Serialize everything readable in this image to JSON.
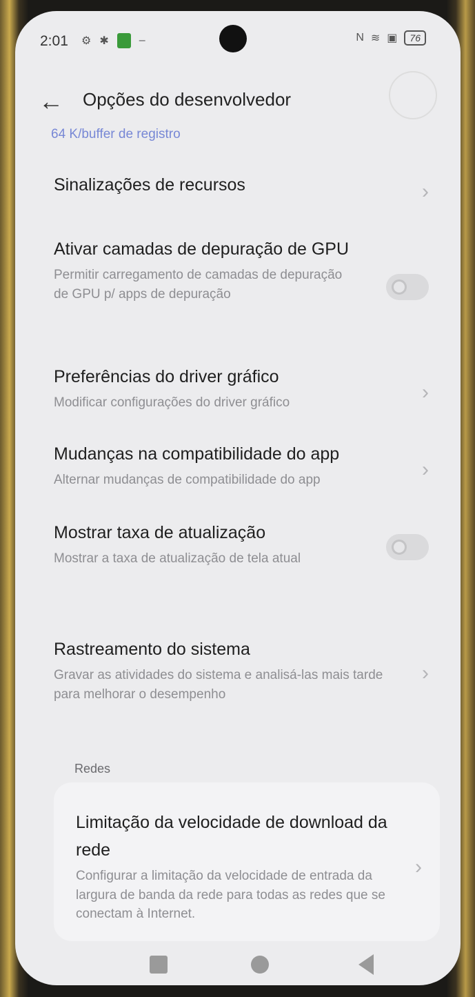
{
  "status": {
    "time": "2:01",
    "battery": "76"
  },
  "header": {
    "title": "Opções do desenvolvedor"
  },
  "cut_off_text": "64 K/buffer de registro",
  "items": [
    {
      "title": "Sinalizações de recursos",
      "subtitle": "",
      "control": "chevron"
    },
    {
      "title": "Ativar camadas de depuração de GPU",
      "subtitle": "Permitir carregamento de camadas de depuração de GPU p/ apps de depuração",
      "control": "toggle",
      "state": "off"
    },
    {
      "title": "Preferências do driver gráfico",
      "subtitle": "Modificar configurações do driver gráfico",
      "control": "chevron"
    },
    {
      "title": "Mudanças na compatibilidade do app",
      "subtitle": "Alternar mudanças de compatibilidade do app",
      "control": "chevron"
    },
    {
      "title": "Mostrar taxa de atualização",
      "subtitle": "Mostrar a taxa de atualização de tela atual",
      "control": "toggle",
      "state": "off"
    },
    {
      "title": "Rastreamento do sistema",
      "subtitle": "Gravar as atividades do sistema e analisá-las mais tarde para melhorar o desempenho",
      "control": "chevron"
    }
  ],
  "section": {
    "label": "Redes"
  },
  "network_item": {
    "title": "Limitação da velocidade de download da rede",
    "subtitle": "Configurar a limitação da velocidade de entrada da largura de banda da rede para todas as redes que se conectam à Internet."
  }
}
